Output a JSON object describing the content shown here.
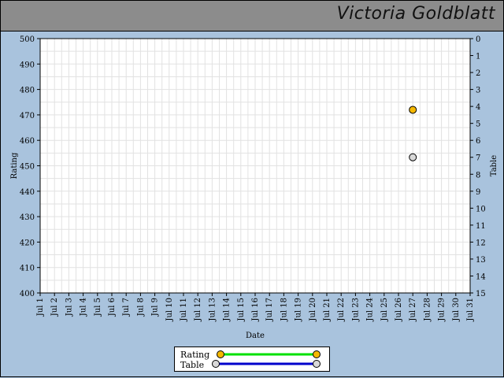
{
  "header": {
    "title": "Victoria Goldblatt"
  },
  "chart_data": {
    "type": "scatter",
    "title": "",
    "xlabel": "Date",
    "ylabel": "Rating",
    "y2label": "Table",
    "x_ticks": [
      "Jul 1",
      "Jul 2",
      "Jul 3",
      "Jul 4",
      "Jul 5",
      "Jul 6",
      "Jul 7",
      "Jul 8",
      "Jul 9",
      "Jul 10",
      "Jul 11",
      "Jul 12",
      "Jul 13",
      "Jul 14",
      "Jul 15",
      "Jul 16",
      "Jul 17",
      "Jul 18",
      "Jul 19",
      "Jul 20",
      "Jul 21",
      "Jul 22",
      "Jul 23",
      "Jul 24",
      "Jul 25",
      "Jul 26",
      "Jul 27",
      "Jul 28",
      "Jul 29",
      "Jul 30",
      "Jul 31"
    ],
    "ylim": [
      400,
      500
    ],
    "y_ticks": [
      400,
      410,
      420,
      430,
      440,
      450,
      460,
      470,
      480,
      490,
      500
    ],
    "y2lim": [
      0,
      15
    ],
    "y2_ticks": [
      0,
      1,
      2,
      3,
      4,
      5,
      6,
      7,
      8,
      9,
      10,
      11,
      12,
      13,
      14,
      15
    ],
    "y2_inverted": true,
    "grid": true,
    "legend_placement": "bottom-center",
    "series": [
      {
        "name": "Rating",
        "axis": "left",
        "x": [
          "Jul 27"
        ],
        "values": [
          472
        ],
        "line_color": "#00e000",
        "marker_color": "#f5b800"
      },
      {
        "name": "Table",
        "axis": "right",
        "x": [
          "Jul 27"
        ],
        "values": [
          7
        ],
        "line_color": "#0000cc",
        "marker_color": "#d8d8d8"
      }
    ]
  }
}
